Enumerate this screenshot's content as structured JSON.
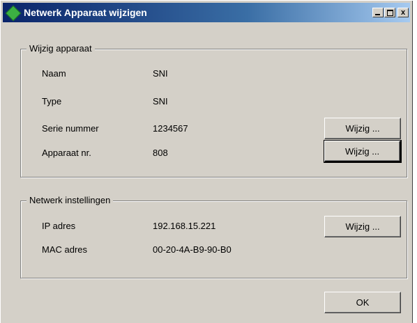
{
  "window": {
    "title": "Netwerk Apparaat wijzigen",
    "buttons": {
      "minimize": "_",
      "maximize": "□",
      "close": "x"
    }
  },
  "device_group": {
    "legend": "Wijzig apparaat",
    "rows": [
      {
        "label": "Naam",
        "value": "SNI"
      },
      {
        "label": "Type",
        "value": "SNI"
      },
      {
        "label": "Serie nummer",
        "value": "1234567",
        "button": "Wijzig ..."
      },
      {
        "label": "Apparaat nr.",
        "value": "808",
        "button": "Wijzig ..."
      }
    ]
  },
  "network_group": {
    "legend": "Netwerk instellingen",
    "rows": [
      {
        "label": "IP adres",
        "value": "192.168.15.221",
        "button": "Wijzig ..."
      },
      {
        "label": "MAC adres",
        "value": "00-20-4A-B9-90-B0"
      }
    ]
  },
  "ok_label": "OK",
  "colors": {
    "titlebar_start": "#0a246a",
    "titlebar_end": "#a6caf0",
    "face": "#d4d0c8",
    "icon": "#3cb043"
  }
}
